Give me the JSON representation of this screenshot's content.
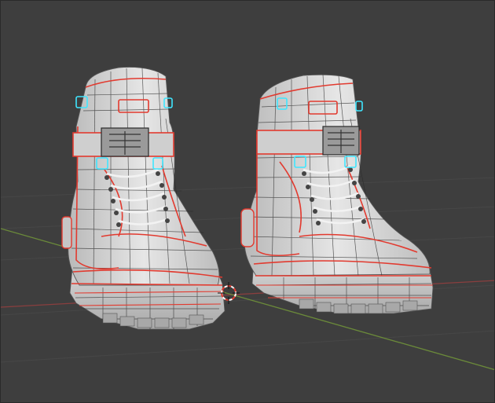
{
  "viewport": {
    "background": "#3e3e3e",
    "grid_color": "#4a4a4a"
  },
  "axes": {
    "x_axis_color": "#8a3e3e",
    "y_axis_color": "#6b8a3a"
  },
  "mesh": {
    "surface_color": "#d9d9d9",
    "wire_color": "#2a2a2a",
    "seam_color": "#e23a2f",
    "selected_color": "#3fe6ff"
  },
  "cursor": {
    "icon": "3d-cursor-icon",
    "ring_colors": [
      "#e23a2f",
      "#ffffff"
    ]
  },
  "objects": [
    {
      "icon": "boot-mesh-icon",
      "side": "left"
    },
    {
      "icon": "boot-mesh-icon",
      "side": "right"
    }
  ]
}
